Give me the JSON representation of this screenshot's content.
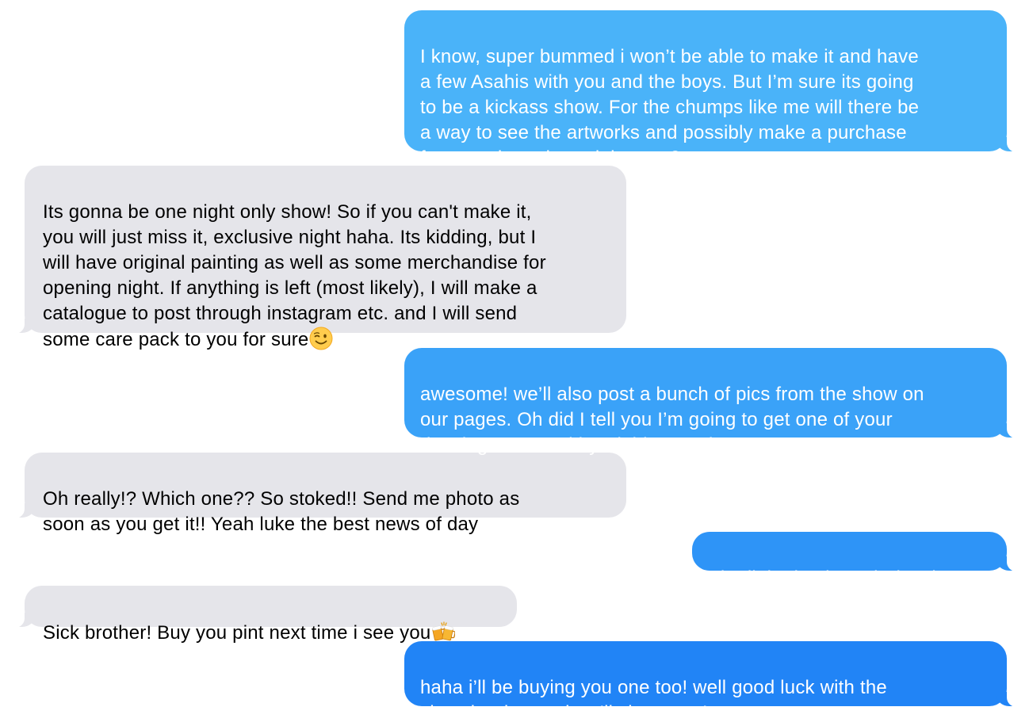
{
  "conversation": {
    "messages": [
      {
        "direction": "outgoing",
        "text": "I know, super bummed i won’t be able to make it and have\na few Asahis with you and the boys. But I’m sure its going\nto be a kickass show. For the chumps like me will there be\na way to see the artworks and possibly make a purchase\nfrom our homebound thrones?"
      },
      {
        "direction": "incoming",
        "text": "Its gonna be one night only show! So if you can't make it,\nyou will just miss it, exclusive night haha. Its kidding, but I\nwill have original painting as well as some merchandise for\nopening night. If anything is left (most likely), I will make a\ncatalogue to post through instagram etc. and I will send\nsome care pack to you for sure",
        "emoji": "winking-face"
      },
      {
        "direction": "outgoing",
        "text": "awesome! we’ll also post a bunch of pics from the show on\nour pages. Oh did I tell you I’m going to get one of your\ndrawings tattooed by Siobhan real soon?"
      },
      {
        "direction": "incoming",
        "text": "Oh really!? Which one?? So stoked!! Send me photo as\nsoon as you get it!! Yeah luke the best news of day"
      },
      {
        "direction": "outgoing",
        "text": "The little death moth drawing"
      },
      {
        "direction": "incoming",
        "text": "Sick brother! Buy you pint next time i see you",
        "emoji": "clinking-beer-mugs"
      },
      {
        "direction": "outgoing",
        "text": "haha i’ll be buying you one too! well good luck with the\nshow brother and we’ll chat soon!"
      }
    ]
  },
  "colors": {
    "incoming_bubble": "#e5e5ea",
    "outgoing_gradient": [
      "#4ab3f9",
      "#3aa2f8",
      "#2e94f7",
      "#2184f6"
    ],
    "incoming_text": "#000000",
    "outgoing_text": "#ffffff"
  }
}
